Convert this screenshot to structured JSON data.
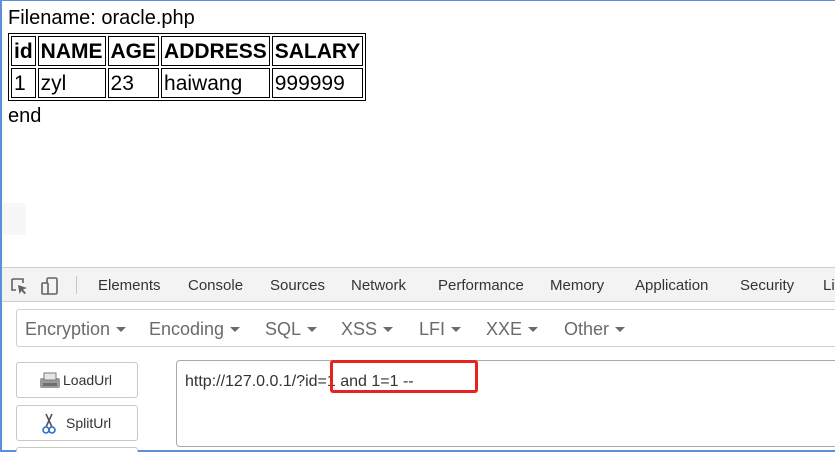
{
  "page": {
    "filename_label": "Filename: oracle.php",
    "table": {
      "headers": [
        "id",
        "NAME",
        "AGE",
        "ADDRESS",
        "SALARY"
      ],
      "rows": [
        [
          "1",
          "zyl",
          "23",
          "haiwang",
          "999999"
        ]
      ]
    },
    "end_text": "end"
  },
  "devtools": {
    "tabs": [
      "Elements",
      "Console",
      "Sources",
      "Network",
      "Performance",
      "Memory",
      "Application",
      "Security",
      "Li"
    ]
  },
  "hackbar": {
    "menus": [
      "Encryption",
      "Encoding",
      "SQL",
      "XSS",
      "LFI",
      "XXE",
      "Other"
    ],
    "buttons": {
      "load_url": "LoadUrl",
      "split_url": "SplitUrl"
    },
    "url_value": "http://127.0.0.1/?id=1 and 1=1 --"
  },
  "colors": {
    "highlight": "#e8221d",
    "window_border": "#5b8fd6"
  },
  "icons": {
    "inspect": "inspect-element-icon",
    "device": "device-toolbar-icon",
    "load": "load-url-icon",
    "split": "scissors-icon"
  }
}
